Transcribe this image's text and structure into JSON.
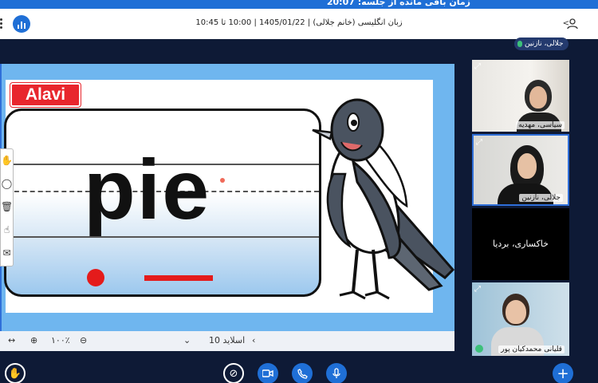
{
  "top_strip": {
    "text": "زمان باقی مانده از جلسه: 20:07"
  },
  "header": {
    "title": "زبان انگلیسی (خانم جلالی) | 1405/01/22 | 10:00 تا 10:45",
    "stats_icon": "bar-chart-icon",
    "user_icon": "user-icon"
  },
  "presenter": {
    "name": "جلالی، نازنین"
  },
  "slide": {
    "logo_text": "Alavi",
    "word": "pie"
  },
  "presentation_toolbar": {
    "zoom": "۱۰۰٪",
    "slide_label": "اسلاید 10"
  },
  "participants": [
    {
      "name": "سیاسی، مهدیه"
    },
    {
      "name": "جلالی، نازنین"
    },
    {
      "name": "خاکساری، بردیا"
    },
    {
      "name": "قلیانی محمدکیان پور"
    }
  ],
  "colors": {
    "accent": "#1f6fd6",
    "background": "#0e1a36",
    "red": "#e41b1b"
  }
}
